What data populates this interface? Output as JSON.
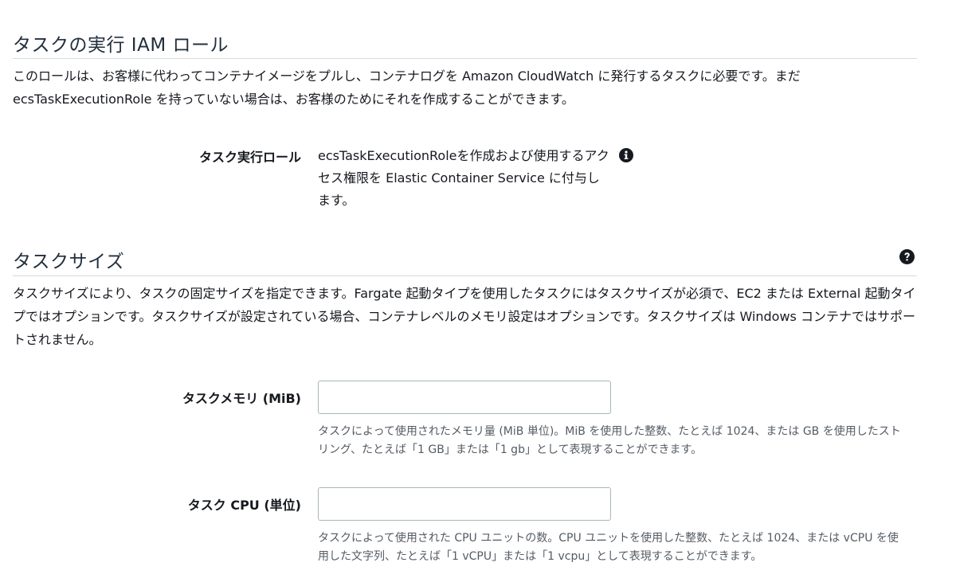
{
  "iam_section": {
    "title": "タスクの実行 IAM ロール",
    "description": "このロールは、お客様に代わってコンテナイメージをプルし、コンテナログを Amazon CloudWatch に発行するタスクに必要です。まだ ecsTaskExecutionRole を持っていない場合は、お客様のためにそれを作成することができます。",
    "role_label": "タスク実行ロール",
    "role_value": "ecsTaskExecutionRoleを作成および使用するアクセス権限を Elastic Container Service に付与します。",
    "info_icon": "info-circle-icon"
  },
  "task_size_section": {
    "title": "タスクサイズ",
    "help_icon": "question-circle-icon",
    "description": "タスクサイズにより、タスクの固定サイズを指定できます。Fargate 起動タイプを使用したタスクにはタスクサイズが必須で、EC2 または External 起動タイプではオプションです。タスクサイズが設定されている場合、コンテナレベルのメモリ設定はオプションです。タスクサイズは Windows コンテナではサポートされません。",
    "memory": {
      "label": "タスクメモリ (MiB)",
      "value": "",
      "hint": "タスクによって使用されたメモリ量 (MiB 単位)。MiB を使用した整数、たとえば 1024、または GB を使用したストリング、たとえば「1 GB」または「1 gb」として表現することができます。"
    },
    "cpu": {
      "label": "タスク CPU (単位)",
      "value": "",
      "hint": "タスクによって使用された CPU ユニットの数。CPU ユニットを使用した整数、たとえば 1024、または vCPU を使用した文字列、たとえば「1 vCPU」または「1 vcpu」として表現することができます。"
    }
  },
  "colors": {
    "text": "#16191f",
    "hint": "#545b64",
    "rule": "#d5dbdb",
    "input_border": "#aab7b8",
    "icon": "#16191f"
  }
}
